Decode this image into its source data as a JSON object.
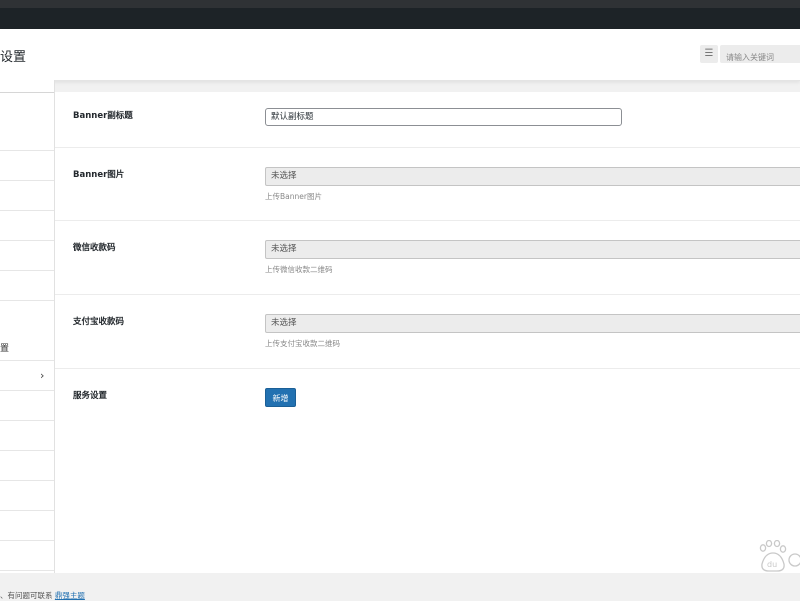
{
  "header": {
    "title": "设置",
    "search_placeholder": "请输入关键词",
    "search_toggle_icon": "list-icon"
  },
  "sidebar": {
    "items": [
      {
        "label": ""
      },
      {
        "label": ""
      },
      {
        "label": ""
      },
      {
        "label": ""
      },
      {
        "label": ""
      },
      {
        "label": ""
      },
      {
        "label": ""
      },
      {
        "label": "置"
      },
      {
        "label": "",
        "has_chevron": true
      },
      {
        "label": ""
      },
      {
        "label": ""
      },
      {
        "label": ""
      },
      {
        "label": ""
      },
      {
        "label": ""
      },
      {
        "label": ""
      }
    ],
    "chevron_icon": "chevron-right-icon"
  },
  "form": {
    "banner_subtitle": {
      "label": "Banner副标题",
      "value": "默认副标题"
    },
    "banner_image": {
      "label": "Banner图片",
      "value": "未选择",
      "hint": "上传Banner图片"
    },
    "wechat_qr": {
      "label": "微信收款码",
      "value": "未选择",
      "hint": "上传微信收款二维码"
    },
    "alipay_qr": {
      "label": "支付宝收款码",
      "value": "未选择",
      "hint": "上传支付宝收款二维码"
    },
    "service_settings": {
      "label": "服务设置",
      "button_label": "新增"
    }
  },
  "footer": {
    "text": "、有问题可联系",
    "link_text": "鼎强主题"
  },
  "colors": {
    "admin_bar": "#1d2327",
    "primary_button": "#2271b1",
    "page_background": "#f1f1f1"
  },
  "watermark": {
    "label": "du"
  }
}
